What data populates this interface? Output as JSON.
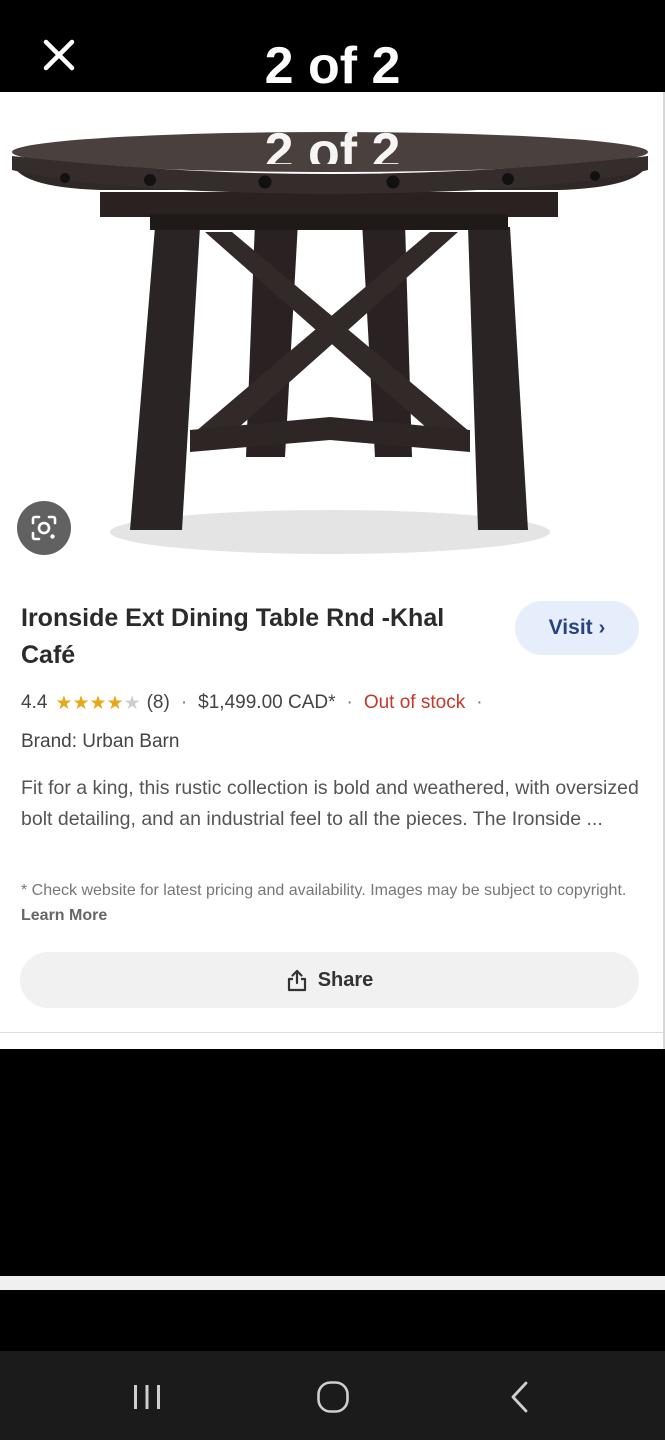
{
  "viewer": {
    "counter_text": "2 of 2",
    "close_icon": "close-icon"
  },
  "product": {
    "image_ghost_text": "2 of 2",
    "title": "Ironside Ext Dining Table Rnd -Khal Café",
    "visit_label": "Visit",
    "rating": "4.4",
    "stars": 4.4,
    "review_count": "(8)",
    "price": "$1,499.00 CAD*",
    "stock_status": "Out of stock",
    "brand": "Brand: Urban Barn",
    "description": "Fit for a king, this rustic collection is bold and weathered, with oversized bolt detailing, and an industrial feel to all the pieces. The Ironside ...",
    "disclaimer": "* Check website for latest pricing and availability. Images may be subject to copyright.",
    "learn_more": "Learn More",
    "share_label": "Share"
  },
  "colors": {
    "accent_visit_bg": "#e7eefb",
    "accent_visit_text": "#274480",
    "star": "#e6a817",
    "out_of_stock": "#c5382c"
  },
  "navbar": {
    "recents_icon": "recents-icon",
    "home_icon": "home-icon",
    "back_icon": "back-icon"
  }
}
